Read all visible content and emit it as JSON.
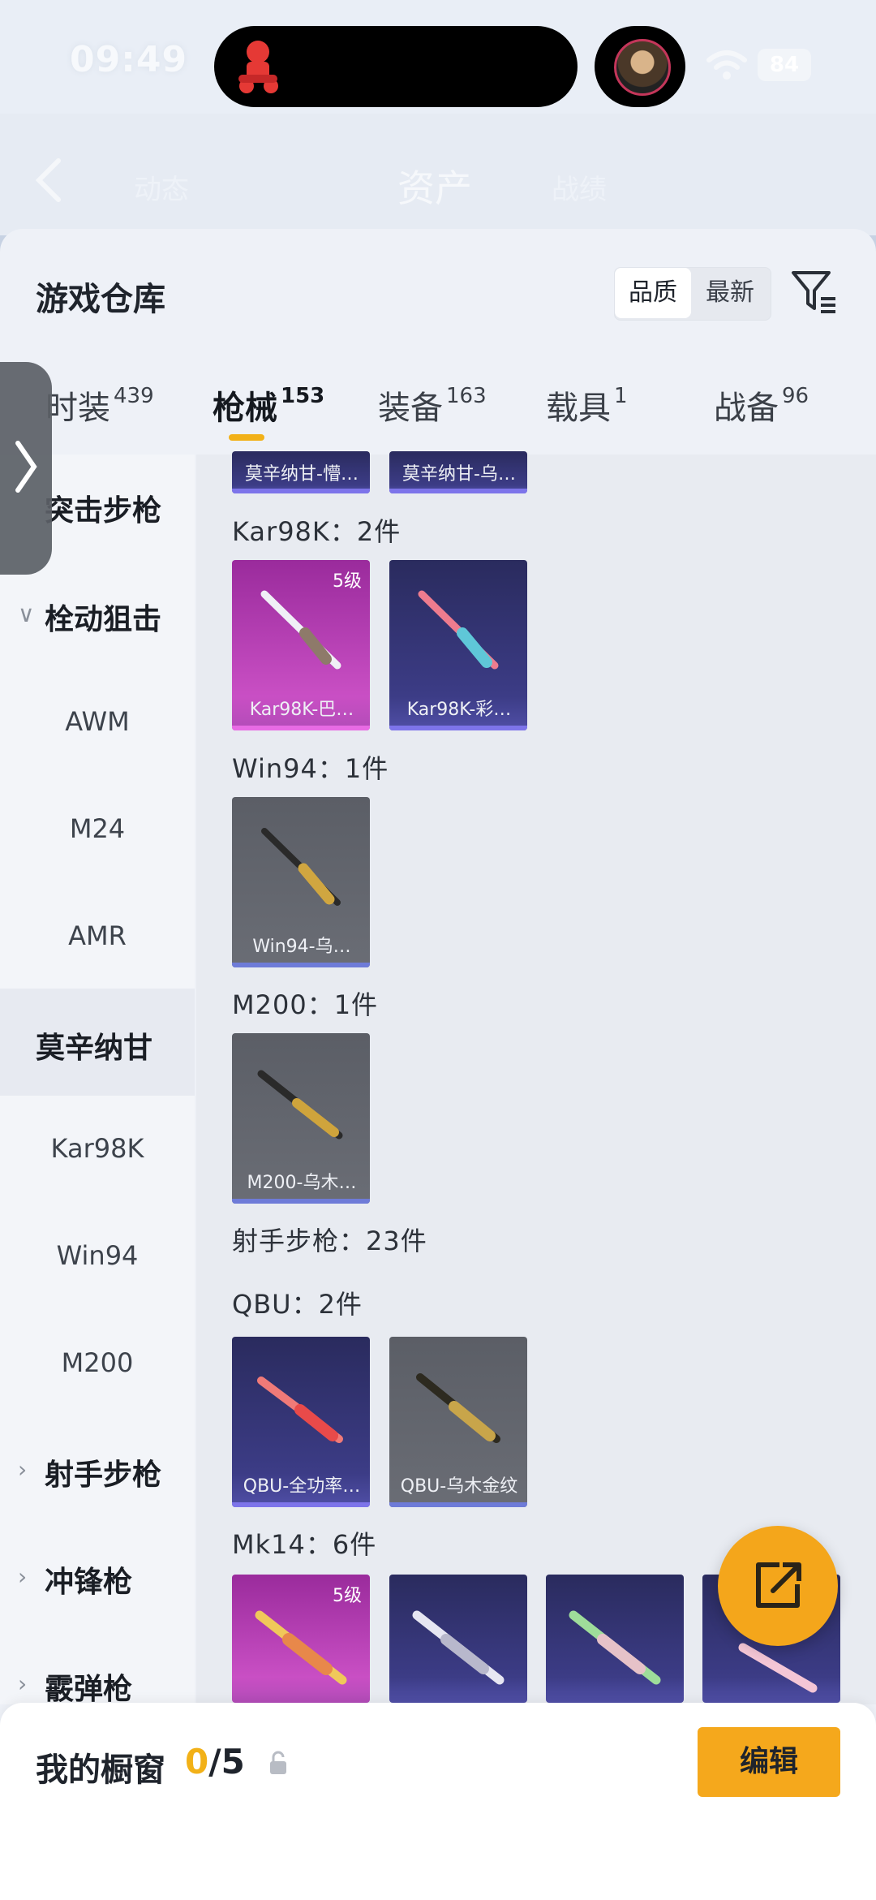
{
  "status_bar": {
    "time": "09:49",
    "battery": "84"
  },
  "nav": {
    "title": "资产",
    "left_tab": "动态",
    "right_tab": "战绩"
  },
  "header": {
    "title": "游戏仓库",
    "sort_options": [
      "品质",
      "最新"
    ],
    "active_sort": "品质"
  },
  "tabs": [
    {
      "label": "时装",
      "count": "439"
    },
    {
      "label": "枪械",
      "count": "153",
      "active": true
    },
    {
      "label": "装备",
      "count": "163"
    },
    {
      "label": "载具",
      "count": "1"
    },
    {
      "label": "战备",
      "count": "96"
    }
  ],
  "sidebar": {
    "items": [
      {
        "label": "突击步枪",
        "kind": "category"
      },
      {
        "label": "栓动狙击",
        "kind": "category",
        "expanded": true
      },
      {
        "label": "AWM",
        "kind": "sub"
      },
      {
        "label": "M24",
        "kind": "sub"
      },
      {
        "label": "AMR",
        "kind": "sub"
      },
      {
        "label": "莫辛纳甘",
        "kind": "sub",
        "active": true
      },
      {
        "label": "Kar98K",
        "kind": "sub"
      },
      {
        "label": "Win94",
        "kind": "sub"
      },
      {
        "label": "M200",
        "kind": "sub"
      },
      {
        "label": "射手步枪",
        "kind": "category"
      },
      {
        "label": "冲锋枪",
        "kind": "category"
      },
      {
        "label": "霰弹枪",
        "kind": "category"
      }
    ]
  },
  "content": {
    "top_partial_cards": [
      "莫辛纳甘-懵…",
      "莫辛纳甘-乌…"
    ],
    "groups": [
      {
        "label": "Kar98K：2件",
        "cards": [
          {
            "name": "Kar98K-巴…",
            "level": "5级",
            "rarity": "pink"
          },
          {
            "name": "Kar98K-彩…",
            "rarity": "purple"
          }
        ]
      },
      {
        "label": "Win94：1件",
        "cards": [
          {
            "name": "Win94-乌…",
            "rarity": "grey"
          }
        ]
      },
      {
        "label": "M200：1件",
        "cards": [
          {
            "name": "M200-乌木…",
            "rarity": "grey"
          }
        ]
      },
      {
        "label": "射手步枪：23件",
        "cards": []
      },
      {
        "label": "QBU：2件",
        "cards": [
          {
            "name": "QBU-全功率…",
            "rarity": "purple"
          },
          {
            "name": "QBU-乌木金纹",
            "rarity": "grey"
          }
        ]
      },
      {
        "label": "Mk14：6件",
        "cards": [
          {
            "name": "",
            "level": "5级",
            "rarity": "pink"
          },
          {
            "name": "",
            "rarity": "purple"
          },
          {
            "name": "",
            "rarity": "purple"
          },
          {
            "name": "",
            "rarity": "purple"
          }
        ]
      }
    ]
  },
  "bottom_bar": {
    "label": "我的橱窗",
    "current": "0",
    "total": "/5",
    "edit_label": "编辑"
  },
  "colors": {
    "accent": "#f2b118",
    "button": "#f5a81c",
    "pink_rarity": "#c94fc4",
    "purple_rarity": "#3c3c86"
  }
}
